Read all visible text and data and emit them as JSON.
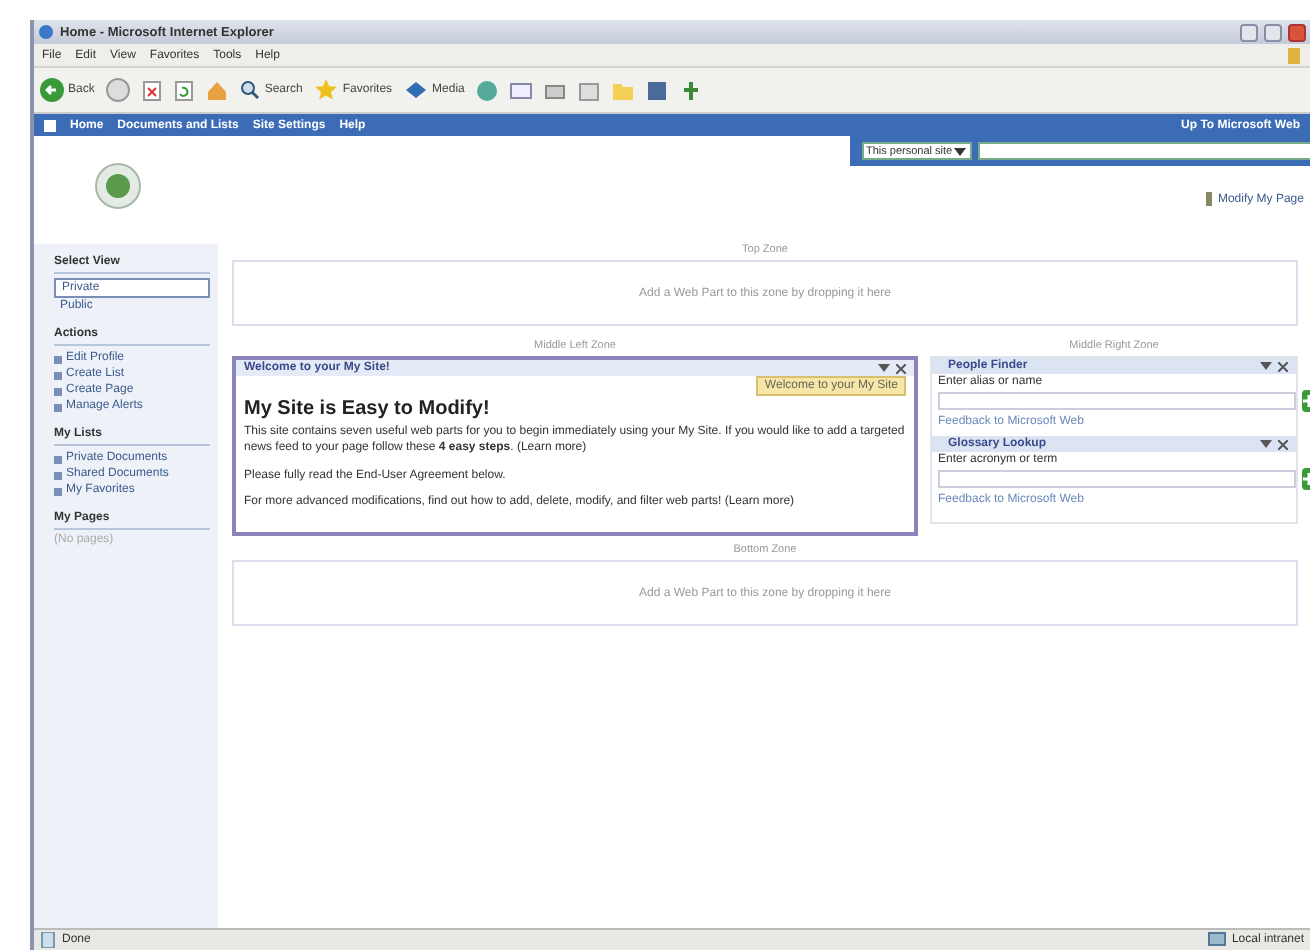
{
  "window": {
    "title": "Home - Microsoft Internet Explorer"
  },
  "menu": [
    "File",
    "Edit",
    "View",
    "Favorites",
    "Tools",
    "Help"
  ],
  "toolbar": {
    "back": "Back",
    "search": "Search",
    "favorites": "Favorites",
    "media": "Media"
  },
  "nav": {
    "links": [
      "Home",
      "Documents and Lists",
      "Site Settings",
      "Help"
    ],
    "up_link": "Up To Microsoft Web"
  },
  "search": {
    "scope": "This personal site"
  },
  "modify_link": "Modify My Page",
  "sidebar": {
    "sections": [
      {
        "title": "Select View",
        "kind": "views",
        "items": [
          {
            "label": "Private",
            "selected": true
          },
          {
            "label": "Public",
            "selected": false
          }
        ]
      },
      {
        "title": "Actions",
        "kind": "links",
        "items": [
          {
            "label": "Edit Profile"
          },
          {
            "label": "Create List"
          },
          {
            "label": "Create Page"
          },
          {
            "label": "Manage Alerts"
          }
        ]
      },
      {
        "title": "My Lists",
        "kind": "links",
        "items": [
          {
            "label": "Private Documents"
          },
          {
            "label": "Shared Documents"
          },
          {
            "label": "My Favorites"
          }
        ]
      },
      {
        "title": "My Pages",
        "kind": "empty",
        "items": [
          {
            "label": "(No pages)"
          }
        ]
      }
    ]
  },
  "zones": {
    "top": {
      "label": "Top Zone",
      "hint": "Add a Web Part to this zone by dropping it here"
    },
    "middle_left": {
      "label": "Middle Left Zone"
    },
    "middle_right": {
      "label": "Middle Right Zone"
    },
    "bottom": {
      "label": "Bottom Zone",
      "hint": "Add a Web Part to this zone by dropping it here"
    }
  },
  "welcome_part": {
    "title": "Welcome to your My Site!",
    "badge": "Welcome to your My Site",
    "heading": "My Site is Easy to Modify!",
    "paragraphs": [
      "This site contains seven useful web parts for you to begin immediately using your My Site. If you would like to add a targeted news feed to your page follow these **4 easy steps**. (Learn more)",
      "Please fully read the End-User Agreement below.",
      "For more advanced modifications, find out how to add, delete, modify, and filter web parts! (Learn more)"
    ]
  },
  "right_parts": [
    {
      "title": "People Finder",
      "prompt": "Enter alias or name",
      "feedback": "Feedback to Microsoft Web"
    },
    {
      "title": "Glossary Lookup",
      "prompt": "Enter acronym or term",
      "feedback": "Feedback to Microsoft Web"
    }
  ],
  "status_bar": {
    "text": "Done",
    "zone": "Local intranet"
  }
}
